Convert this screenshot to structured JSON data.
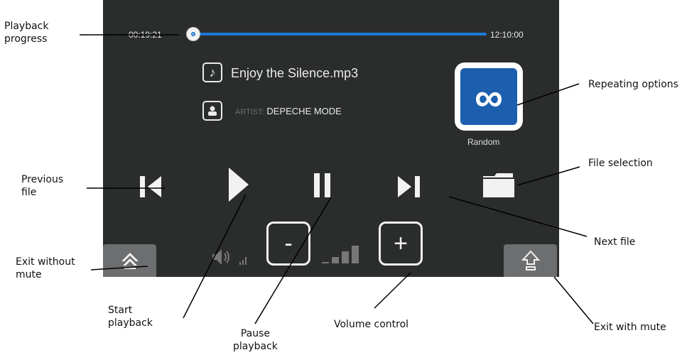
{
  "progress": {
    "elapsed": "00:19:21",
    "total": "12:10:00",
    "fraction": 0.016
  },
  "track": {
    "title": "Enjoy the Silence.mp3",
    "artist_label": "ARTIST:",
    "artist": "DEPECHE MODE"
  },
  "repeat": {
    "symbol": "∞",
    "mode": "Random"
  },
  "volume": {
    "minus_label": "-",
    "plus_label": "+",
    "level_bars_filled": 3,
    "level_bars_total": 4
  },
  "callouts": {
    "playback_progress": [
      "Playback",
      "progress"
    ],
    "repeating_options": "Repeating options",
    "file_selection": "File selection",
    "previous_file": [
      "Previous",
      "file"
    ],
    "next_file": "Next file",
    "exit_without_mute": [
      "Exit without",
      "mute"
    ],
    "start_playback": [
      "Start",
      "playback"
    ],
    "pause_playback": [
      "Pause",
      "playback"
    ],
    "volume_control": "Volume control",
    "exit_with_mute": "Exit with mute"
  },
  "colors": {
    "screen_bg": "#2a2d2c",
    "accent": "#1e78d6",
    "repeat_bg": "#1b5fae",
    "side_button": "#6d6e70"
  },
  "icons": [
    "note-icon",
    "person-icon",
    "infinity-icon",
    "skip-previous-icon",
    "play-icon",
    "pause-icon",
    "skip-next-icon",
    "folder-icon",
    "speaker-icon",
    "home-icon",
    "eject-up-icon"
  ]
}
